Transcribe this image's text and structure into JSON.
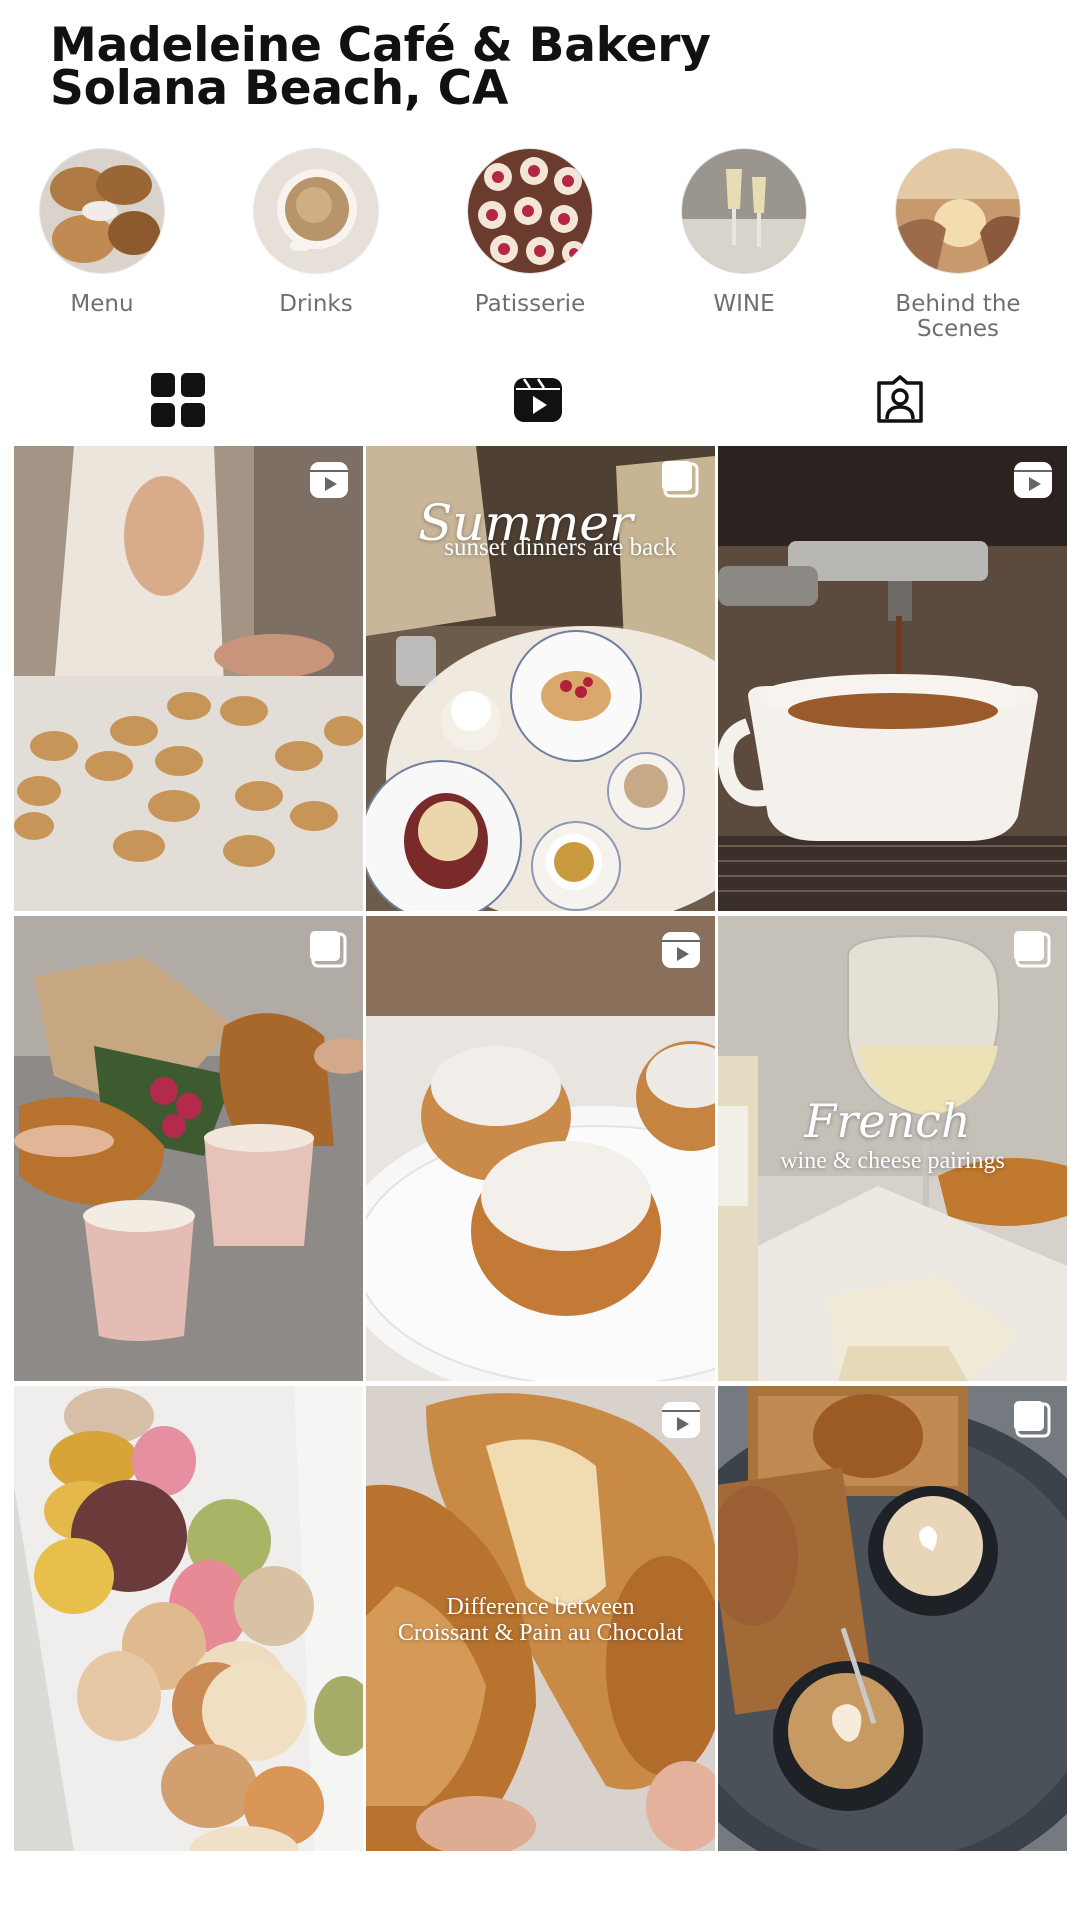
{
  "profile": {
    "name_line1": "Madeleine Café & Bakery",
    "name_line2": "Solana Beach, CA"
  },
  "highlights": [
    {
      "label": "Menu"
    },
    {
      "label": "Drinks"
    },
    {
      "label": "Patisserie"
    },
    {
      "label": "WINE"
    },
    {
      "label": "Behind the Scenes"
    }
  ],
  "tabs": [
    {
      "icon": "grid-icon"
    },
    {
      "icon": "reels-icon"
    },
    {
      "icon": "tagged-icon"
    }
  ],
  "posts": [
    {
      "type": "reel",
      "caption_script": "",
      "caption_sub": ""
    },
    {
      "type": "carousel",
      "caption_script": "Summer",
      "caption_sub": "sunset dinners are back"
    },
    {
      "type": "reel",
      "caption_script": "",
      "caption_sub": ""
    },
    {
      "type": "carousel",
      "caption_script": "",
      "caption_sub": ""
    },
    {
      "type": "reel",
      "caption_script": "",
      "caption_sub": ""
    },
    {
      "type": "carousel",
      "caption_script": "French",
      "caption_sub": "wine & cheese pairings"
    },
    {
      "type": "none",
      "caption_script": "",
      "caption_sub": ""
    },
    {
      "type": "reel",
      "caption_script": "",
      "caption_sub": "Difference between",
      "caption_sub2": "Croissant & Pain au Chocolat"
    },
    {
      "type": "carousel",
      "caption_script": "",
      "caption_sub": ""
    }
  ],
  "colors": {
    "label_gray": "#6f6f6f",
    "icon_black": "#111111"
  }
}
